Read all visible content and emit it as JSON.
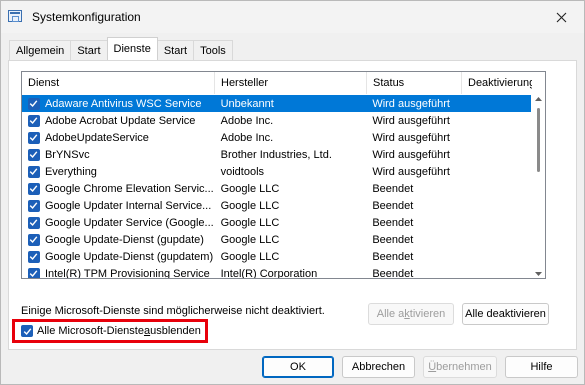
{
  "window": {
    "title": "Systemkonfiguration"
  },
  "tabs": [
    {
      "label": "Allgemein"
    },
    {
      "label": "Start"
    },
    {
      "label": "Dienste"
    },
    {
      "label": "Start"
    },
    {
      "label": "Tools"
    }
  ],
  "list": {
    "headers": {
      "dienst": "Dienst",
      "hersteller": "Hersteller",
      "status": "Status",
      "deaktiviert": "Deaktivierung"
    },
    "rows": [
      {
        "dienst": "Adaware Antivirus WSC Service",
        "hersteller": "Unbekannt",
        "status": "Wird ausgeführt",
        "deaktiviert": ""
      },
      {
        "dienst": "Adobe Acrobat Update Service",
        "hersteller": "Adobe Inc.",
        "status": "Wird ausgeführt",
        "deaktiviert": ""
      },
      {
        "dienst": "AdobeUpdateService",
        "hersteller": "Adobe Inc.",
        "status": "Wird ausgeführt",
        "deaktiviert": ""
      },
      {
        "dienst": "BrYNSvc",
        "hersteller": "Brother Industries, Ltd.",
        "status": "Wird ausgeführt",
        "deaktiviert": ""
      },
      {
        "dienst": "Everything",
        "hersteller": "voidtools",
        "status": "Wird ausgeführt",
        "deaktiviert": ""
      },
      {
        "dienst": "Google Chrome Elevation Servic...",
        "hersteller": "Google LLC",
        "status": "Beendet",
        "deaktiviert": ""
      },
      {
        "dienst": "Google Updater Internal Service...",
        "hersteller": "Google LLC",
        "status": "Beendet",
        "deaktiviert": ""
      },
      {
        "dienst": "Google Updater Service (Google...",
        "hersteller": "Google LLC",
        "status": "Beendet",
        "deaktiviert": ""
      },
      {
        "dienst": "Google Update-Dienst (gupdate)",
        "hersteller": "Google LLC",
        "status": "Beendet",
        "deaktiviert": ""
      },
      {
        "dienst": "Google Update-Dienst (gupdatem)",
        "hersteller": "Google LLC",
        "status": "Beendet",
        "deaktiviert": ""
      },
      {
        "dienst": "Intel(R) TPM Provisioning Service",
        "hersteller": "Intel(R) Corporation",
        "status": "Beendet",
        "deaktiviert": ""
      }
    ],
    "selected_row": 0
  },
  "info_text": "Einige Microsoft-Dienste sind möglicherweise nicht deaktiviert.",
  "buttons": {
    "enable_all_pre": "Alle a",
    "enable_all_u": "k",
    "enable_all_post": "tivieren",
    "disable_all": "Alle deaktivieren",
    "ok": "OK",
    "cancel": "Abbrechen",
    "apply_u": "Ü",
    "apply_post": "bernehmen",
    "help": "Hilfe"
  },
  "hide_ms": {
    "pre": "Alle Microsoft-Dienste ",
    "u": "a",
    "post": "usblenden",
    "checked": true
  },
  "colors": {
    "selection": "#0078d7",
    "checkbox": "#1c5fb8",
    "highlight_box": "#e8000b"
  }
}
